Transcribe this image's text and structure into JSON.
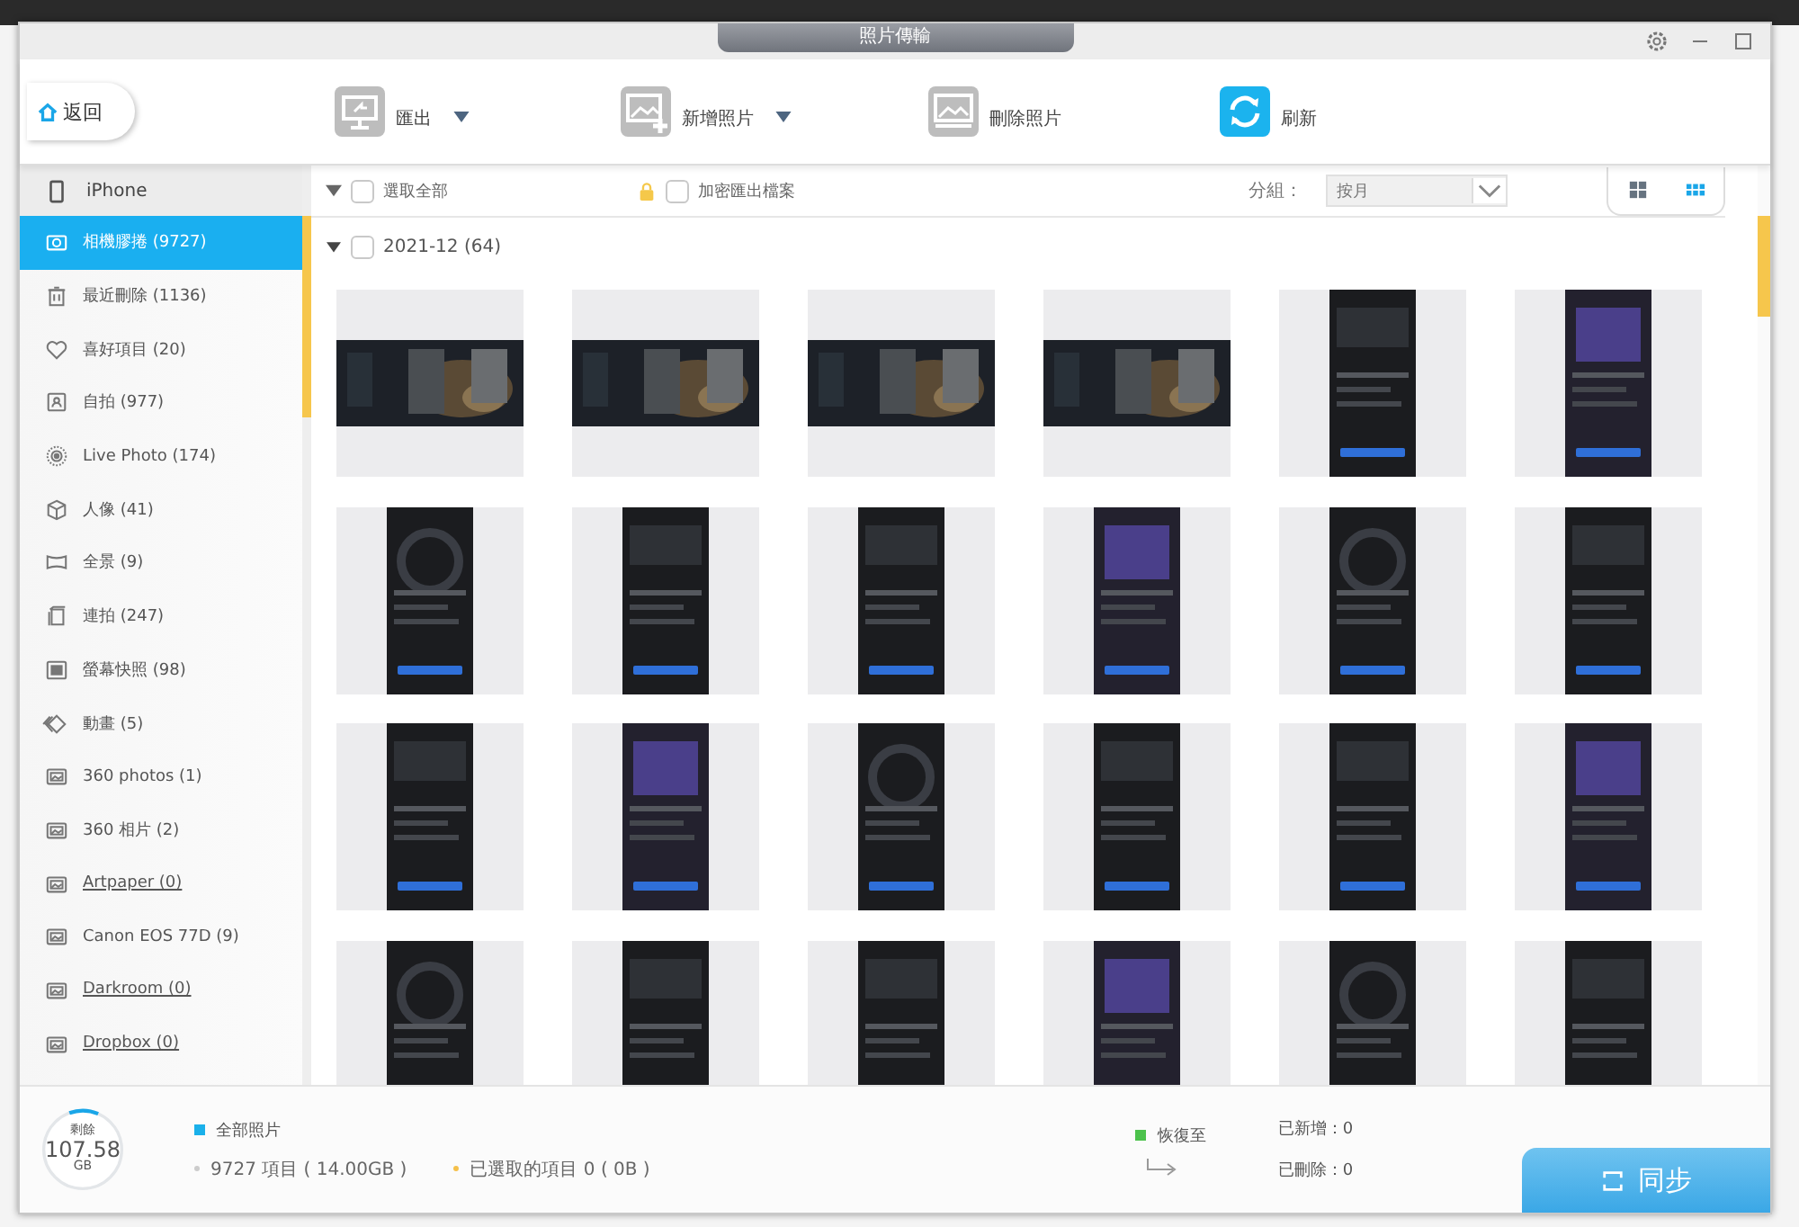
{
  "window": {
    "title": "照片傳輸"
  },
  "toolbar": {
    "back": "返回",
    "actions": [
      {
        "label": "匯出",
        "dropdown": true,
        "kind": "export"
      },
      {
        "label": "新增照片",
        "dropdown": true,
        "kind": "add"
      },
      {
        "label": "刪除照片",
        "dropdown": false,
        "kind": "delete"
      },
      {
        "label": "刷新",
        "dropdown": false,
        "kind": "refresh"
      }
    ]
  },
  "sidebar": {
    "device": "iPhone",
    "items": [
      {
        "label": "相機膠捲 (9727)",
        "selected": true,
        "underlined": false
      },
      {
        "label": "最近刪除 (1136)",
        "selected": false,
        "underlined": false
      },
      {
        "label": "喜好項目 (20)",
        "selected": false,
        "underlined": false
      },
      {
        "label": "自拍 (977)",
        "selected": false,
        "underlined": false
      },
      {
        "label": "Live Photo (174)",
        "selected": false,
        "underlined": false
      },
      {
        "label": "人像 (41)",
        "selected": false,
        "underlined": false
      },
      {
        "label": "全景 (9)",
        "selected": false,
        "underlined": false
      },
      {
        "label": "連拍 (247)",
        "selected": false,
        "underlined": false
      },
      {
        "label": "螢幕快照 (98)",
        "selected": false,
        "underlined": false
      },
      {
        "label": "動畫 (5)",
        "selected": false,
        "underlined": false
      },
      {
        "label": "360 photos (1)",
        "selected": false,
        "underlined": false
      },
      {
        "label": "360 相片 (2)",
        "selected": false,
        "underlined": false
      },
      {
        "label": "Artpaper (0)",
        "selected": false,
        "underlined": true
      },
      {
        "label": "Canon EOS 77D (9)",
        "selected": false,
        "underlined": false
      },
      {
        "label": "Darkroom (0)",
        "selected": false,
        "underlined": true
      },
      {
        "label": "Dropbox (0)",
        "selected": false,
        "underlined": true
      }
    ]
  },
  "filter_bar": {
    "select_all": {
      "label": "選取全部",
      "checked": false
    },
    "encrypt": {
      "label": "加密匯出檔案",
      "checked": false
    },
    "group_label": "分組：",
    "group_value": "按月",
    "views": [
      {
        "kind": "large",
        "selected": false
      },
      {
        "kind": "small",
        "selected": true
      }
    ]
  },
  "group": {
    "label": "2021-12 (64)",
    "expanded": true,
    "checked": false,
    "thumbnails": [
      {
        "kind": "landscape"
      },
      {
        "kind": "landscape"
      },
      {
        "kind": "landscape"
      },
      {
        "kind": "landscape"
      },
      {
        "kind": "portrait"
      },
      {
        "kind": "portrait"
      },
      {
        "kind": "portrait"
      },
      {
        "kind": "portrait"
      },
      {
        "kind": "portrait"
      },
      {
        "kind": "portrait"
      },
      {
        "kind": "portrait"
      },
      {
        "kind": "portrait"
      },
      {
        "kind": "portrait"
      },
      {
        "kind": "portrait"
      },
      {
        "kind": "portrait"
      },
      {
        "kind": "portrait"
      },
      {
        "kind": "portrait"
      },
      {
        "kind": "portrait"
      },
      {
        "kind": "portrait"
      },
      {
        "kind": "portrait"
      },
      {
        "kind": "portrait"
      },
      {
        "kind": "portrait"
      },
      {
        "kind": "portrait"
      },
      {
        "kind": "portrait"
      }
    ]
  },
  "footer": {
    "storage": {
      "label": "剩餘",
      "value": "107.58",
      "unit": "GB",
      "level": 0.12
    },
    "legend": "全部照片",
    "items_count": "9727 項目 ( 14.00GB )",
    "selected_count": "已選取的項目 0 ( 0B )",
    "restore": "恢復至",
    "added": "已新增：0",
    "deleted": "已刪除：0",
    "sync": "同步"
  }
}
